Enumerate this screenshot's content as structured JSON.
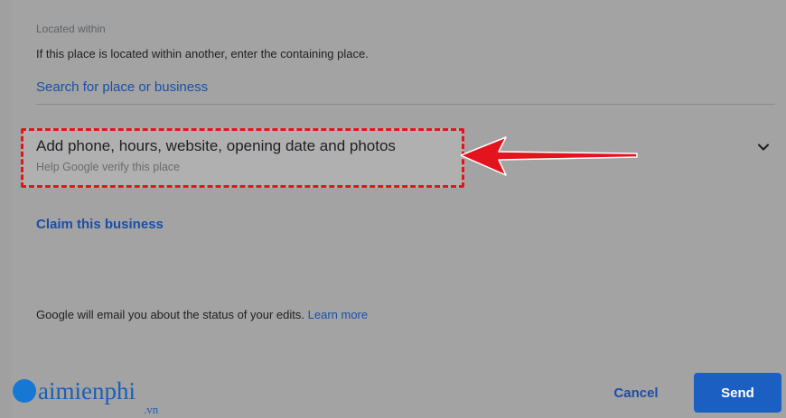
{
  "located": {
    "label": "Located within",
    "help": "If this place is located within another, enter the containing place.",
    "search_link": "Search for place or business"
  },
  "details": {
    "title": "Add phone, hours, website, opening date and photos",
    "subtitle": "Help Google verify this place"
  },
  "claim": {
    "label": "Claim this business"
  },
  "footer": {
    "email_text": "Google will email you about the status of your edits.",
    "learn_more": "Learn more"
  },
  "actions": {
    "cancel": "Cancel",
    "send": "Send"
  },
  "watermark": {
    "text": "aimienphi",
    "sub": ".vn"
  },
  "colors": {
    "link": "#1a4fa8",
    "primary": "#1b5fc3",
    "highlight": "#e3141d",
    "background": "#a3a3a3"
  }
}
